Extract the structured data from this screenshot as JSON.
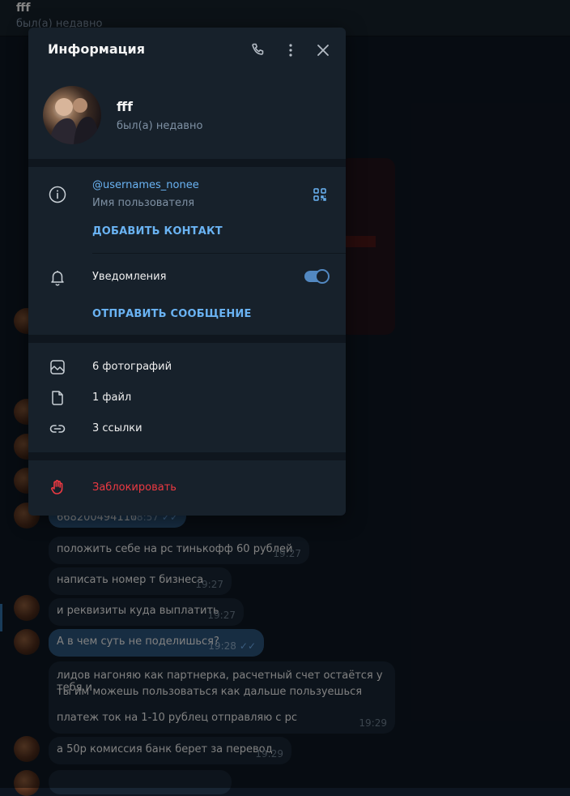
{
  "chat": {
    "title": "fff",
    "status": "был(а) недавно",
    "messages": [
      {
        "text": "66820049411б",
        "time": "18:57"
      },
      {
        "text": "положить себе на рс тинькофф 60 рублей",
        "time": "19:27"
      },
      {
        "text": "написать номер т бизнеса",
        "time": "19:27"
      },
      {
        "text": "и реквизиты куда выплатить",
        "time": "19:27"
      },
      {
        "text": "А в чем суть не поделишься?",
        "time": "19:28"
      },
      {
        "line1": "лидов нагоняю как партнерка, расчетный счет остаётся у тебя и",
        "line2": "ты им можешь пользоваться как дальше пользуешься",
        "line3": "платеж ток на 1-10 рублец отправляю с рс",
        "time": "19:29"
      },
      {
        "text": "а 50р комиссия банк берет за перевод",
        "time": "19:29"
      }
    ]
  },
  "modal": {
    "title": "Информация",
    "profile": {
      "name": "fff",
      "status": "был(а) недавно"
    },
    "username": {
      "value": "@usernames_nonee",
      "label": "Имя пользователя"
    },
    "add_contact": "ДОБАВИТЬ КОНТАКТ",
    "notifications": {
      "label": "Уведомления",
      "enabled": true
    },
    "send_message": "ОТПРАВИТЬ СООБЩЕНИЕ",
    "media": {
      "photos": "6 фотографий",
      "files": "1 файл",
      "links": "3 ссылки"
    },
    "block": "Заблокировать"
  },
  "colors": {
    "accent": "#6ab3f3",
    "danger": "#ec3942",
    "panel": "#17212b",
    "toggle": "#5288c1"
  },
  "icons": [
    "phone-icon",
    "more-vertical-icon",
    "close-icon",
    "info-icon",
    "qr-code-icon",
    "bell-icon",
    "photo-icon",
    "file-icon",
    "link-icon",
    "block-hand-icon"
  ]
}
